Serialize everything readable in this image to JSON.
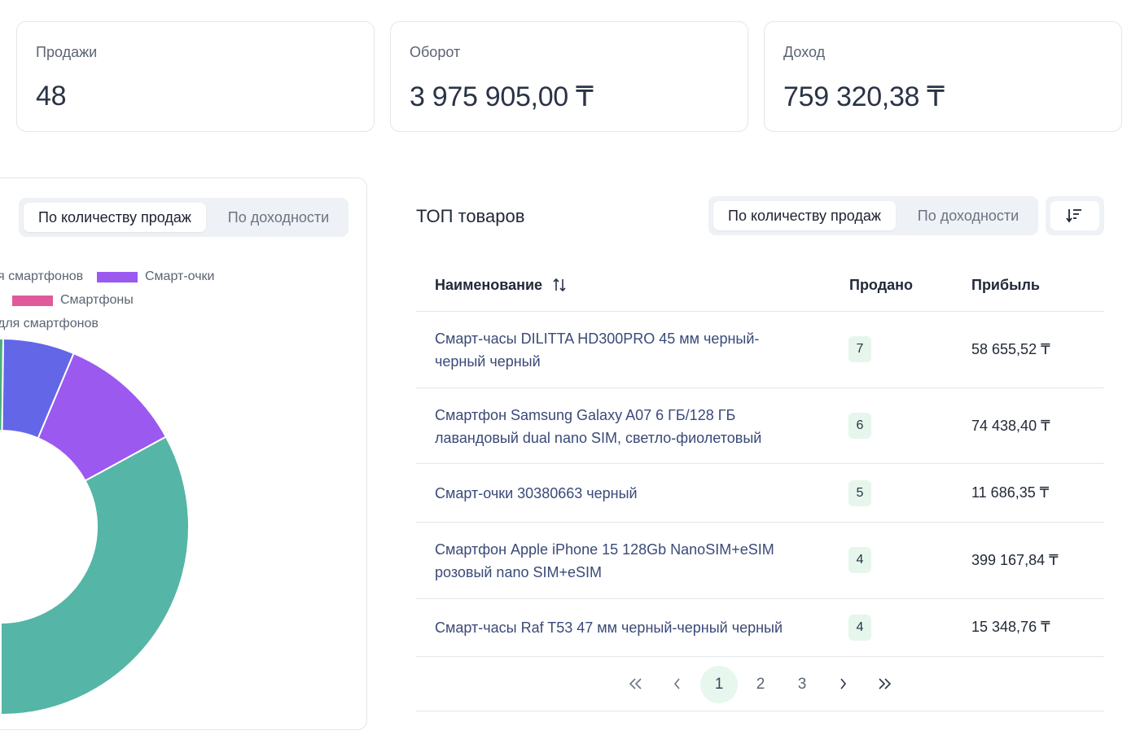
{
  "stats": [
    {
      "label": "Продажи",
      "value": "48"
    },
    {
      "label": "Оборот",
      "value": "3 975 905,00 ₸"
    },
    {
      "label": "Доход",
      "value": "759 320,38 ₸"
    }
  ],
  "chart_panel": {
    "toggle": {
      "active": "По количеству продаж",
      "inactive": "По доходности"
    },
    "legend": [
      {
        "label": "я смартфонов",
        "color": ""
      },
      {
        "label": "Смарт-очки",
        "color": "#9b59f0"
      },
      {
        "label": "Смартфоны",
        "color": "#e05a9a"
      },
      {
        "label": "для смартфонов",
        "color": ""
      }
    ]
  },
  "chart_data": {
    "type": "pie",
    "variant": "donut",
    "slices": [
      {
        "label": "",
        "color": "#4caf7a",
        "value": 1
      },
      {
        "label": "",
        "color": "#6366e6",
        "value": 8
      },
      {
        "label": "Смарт-очки",
        "color": "#9b59f0",
        "value": 14
      },
      {
        "label": "",
        "color": "#55b5a6",
        "value": 43
      }
    ]
  },
  "top": {
    "title": "ТОП товаров",
    "toggle": {
      "active": "По количеству продаж",
      "inactive": "По доходности"
    },
    "sort_icon": "sort-descending-icon",
    "columns": {
      "name": "Наименование",
      "sold": "Продано",
      "profit": "Прибыль"
    },
    "rows": [
      {
        "name": "Смарт-часы DILITTA HD300PRO 45 мм черный-черный черный",
        "sold": "7",
        "profit": "58 655,52 ₸"
      },
      {
        "name": "Смартфон Samsung Galaxy A07 6 ГБ/128 ГБ лавандовый dual nano SIM, светло-фиолетовый",
        "sold": "6",
        "profit": "74 438,40 ₸"
      },
      {
        "name": "Смарт-очки 30380663 черный",
        "sold": "5",
        "profit": "11 686,35 ₸"
      },
      {
        "name": "Смартфон Apple iPhone 15 128Gb NanoSIM+eSIM розовый nano SIM+eSIM",
        "sold": "4",
        "profit": "399 167,84 ₸"
      },
      {
        "name": "Смарт-часы Raf T53 47 мм черный-черный черный",
        "sold": "4",
        "profit": "15 348,76 ₸"
      }
    ],
    "pagination": {
      "pages": [
        "1",
        "2",
        "3"
      ],
      "current": "1"
    }
  }
}
